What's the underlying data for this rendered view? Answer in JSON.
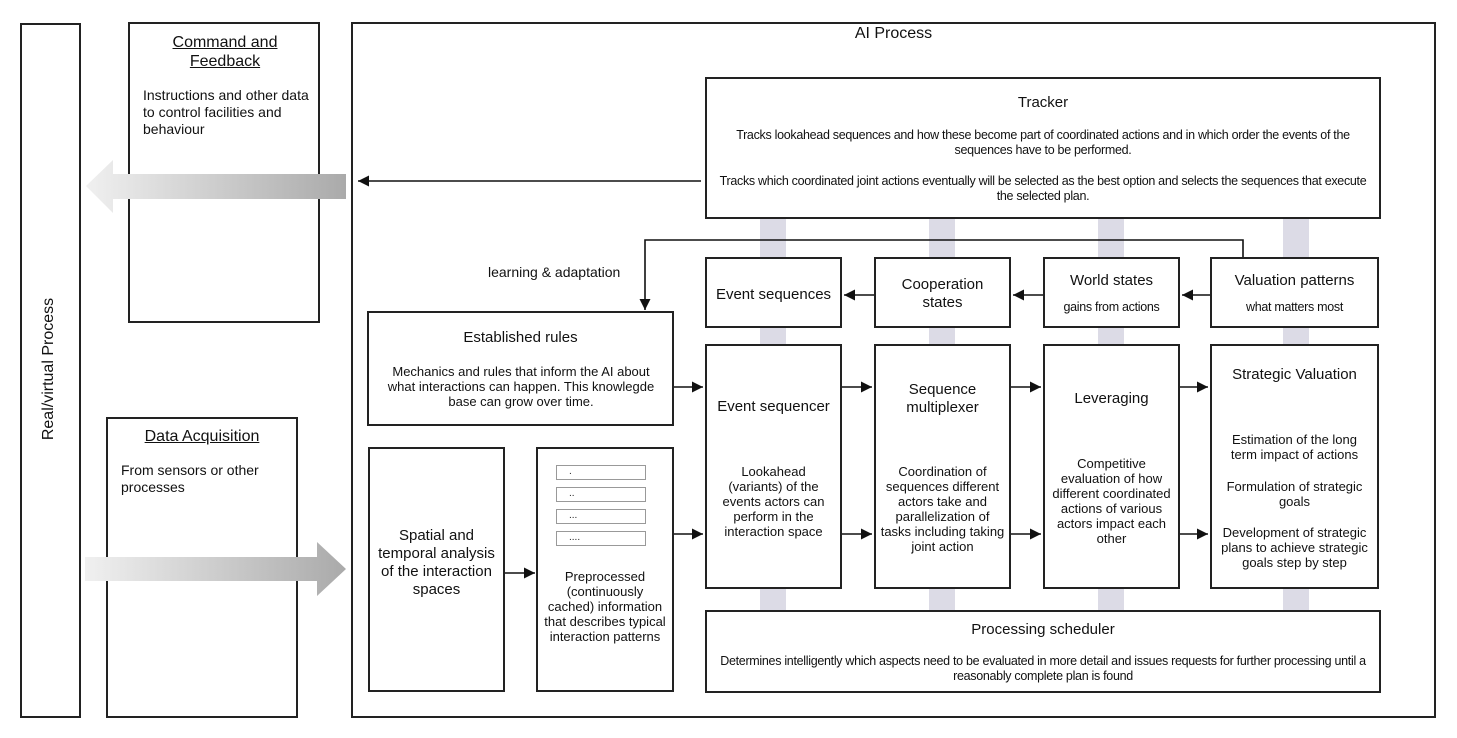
{
  "outer": {
    "real_virtual_label": "Real/virtual Process",
    "ai_process_title": "AI Process"
  },
  "command_feedback": {
    "title": "Command and Feedback",
    "description": "Instructions and other data to control facilities and behaviour"
  },
  "data_acquisition": {
    "title": "Data Acquisition",
    "description": "From sensors or other processes"
  },
  "tracker": {
    "title": "Tracker",
    "paragraph1": "Tracks lookahead sequences and how these become part of coordinated actions and in which order the events of the sequences have to be performed.",
    "paragraph2": "Tracks which coordinated joint actions eventually will be selected as the best option and selects the sequences that execute the selected plan."
  },
  "learning_label": "learning & adaptation",
  "established_rules": {
    "title": "Established rules",
    "description": "Mechanics and rules that inform the AI about what interactions can happen. This knowlegde base can grow over time."
  },
  "states": [
    {
      "title": "Event sequences",
      "subtitle": ""
    },
    {
      "title": "Cooperation states",
      "subtitle": ""
    },
    {
      "title": "World states",
      "subtitle": "gains from actions"
    },
    {
      "title": "Valuation patterns",
      "subtitle": "what matters most"
    }
  ],
  "processors": [
    {
      "title": "Event sequencer",
      "description": "Lookahead (variants) of the events actors can perform in the interaction space"
    },
    {
      "title": "Sequence multiplexer",
      "description": "Coordination of sequences different actors take and parallelization of tasks including taking joint action"
    },
    {
      "title": "Leveraging",
      "description": "Competitive evaluation of how different coordinated actions of various actors impact each other"
    },
    {
      "title": "Strategic Valuation",
      "items": [
        "Estimation of the long term impact of actions",
        "Formulation of strategic goals",
        "Development of strategic plans to achieve strategic goals step by step"
      ]
    }
  ],
  "spatial_analysis": {
    "title": "Spatial and temporal analysis of the interaction spaces"
  },
  "preprocessed": {
    "slots": [
      ".",
      "..",
      "...",
      "...."
    ],
    "description": "Preprocessed (continuously cached) information that describes typical interaction patterns"
  },
  "scheduler": {
    "title": "Processing scheduler",
    "description": "Determines intelligently which aspects need to be evaluated in more detail and issues requests for further processing until a reasonably complete plan is found"
  },
  "colors": {
    "connector": "#dcdbe6",
    "line": "#222222",
    "arrow_gradient_light": "#eeeeee",
    "arrow_gradient_dark": "#aaaaaa"
  }
}
